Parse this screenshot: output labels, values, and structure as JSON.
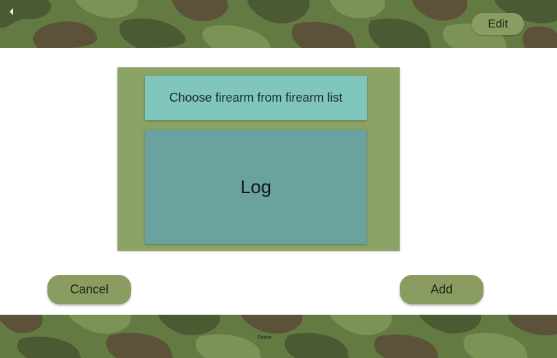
{
  "header": {
    "back_icon": "chevron-left-icon",
    "edit_label": "Edit"
  },
  "main": {
    "choose_label": "Choose firearm from firearm list",
    "log_label": "Log"
  },
  "actions": {
    "cancel_label": "Cancel",
    "add_label": "Add"
  },
  "footer": {
    "label": "Footer"
  },
  "colors": {
    "camo_dark": "#4c5a34",
    "camo_mid": "#647a43",
    "camo_light": "#7d9355",
    "camo_brown": "#5b5239",
    "button": "#8a9c62",
    "panel": "#8ba366",
    "choose": "#7fc6bd",
    "log": "#69a29f"
  }
}
